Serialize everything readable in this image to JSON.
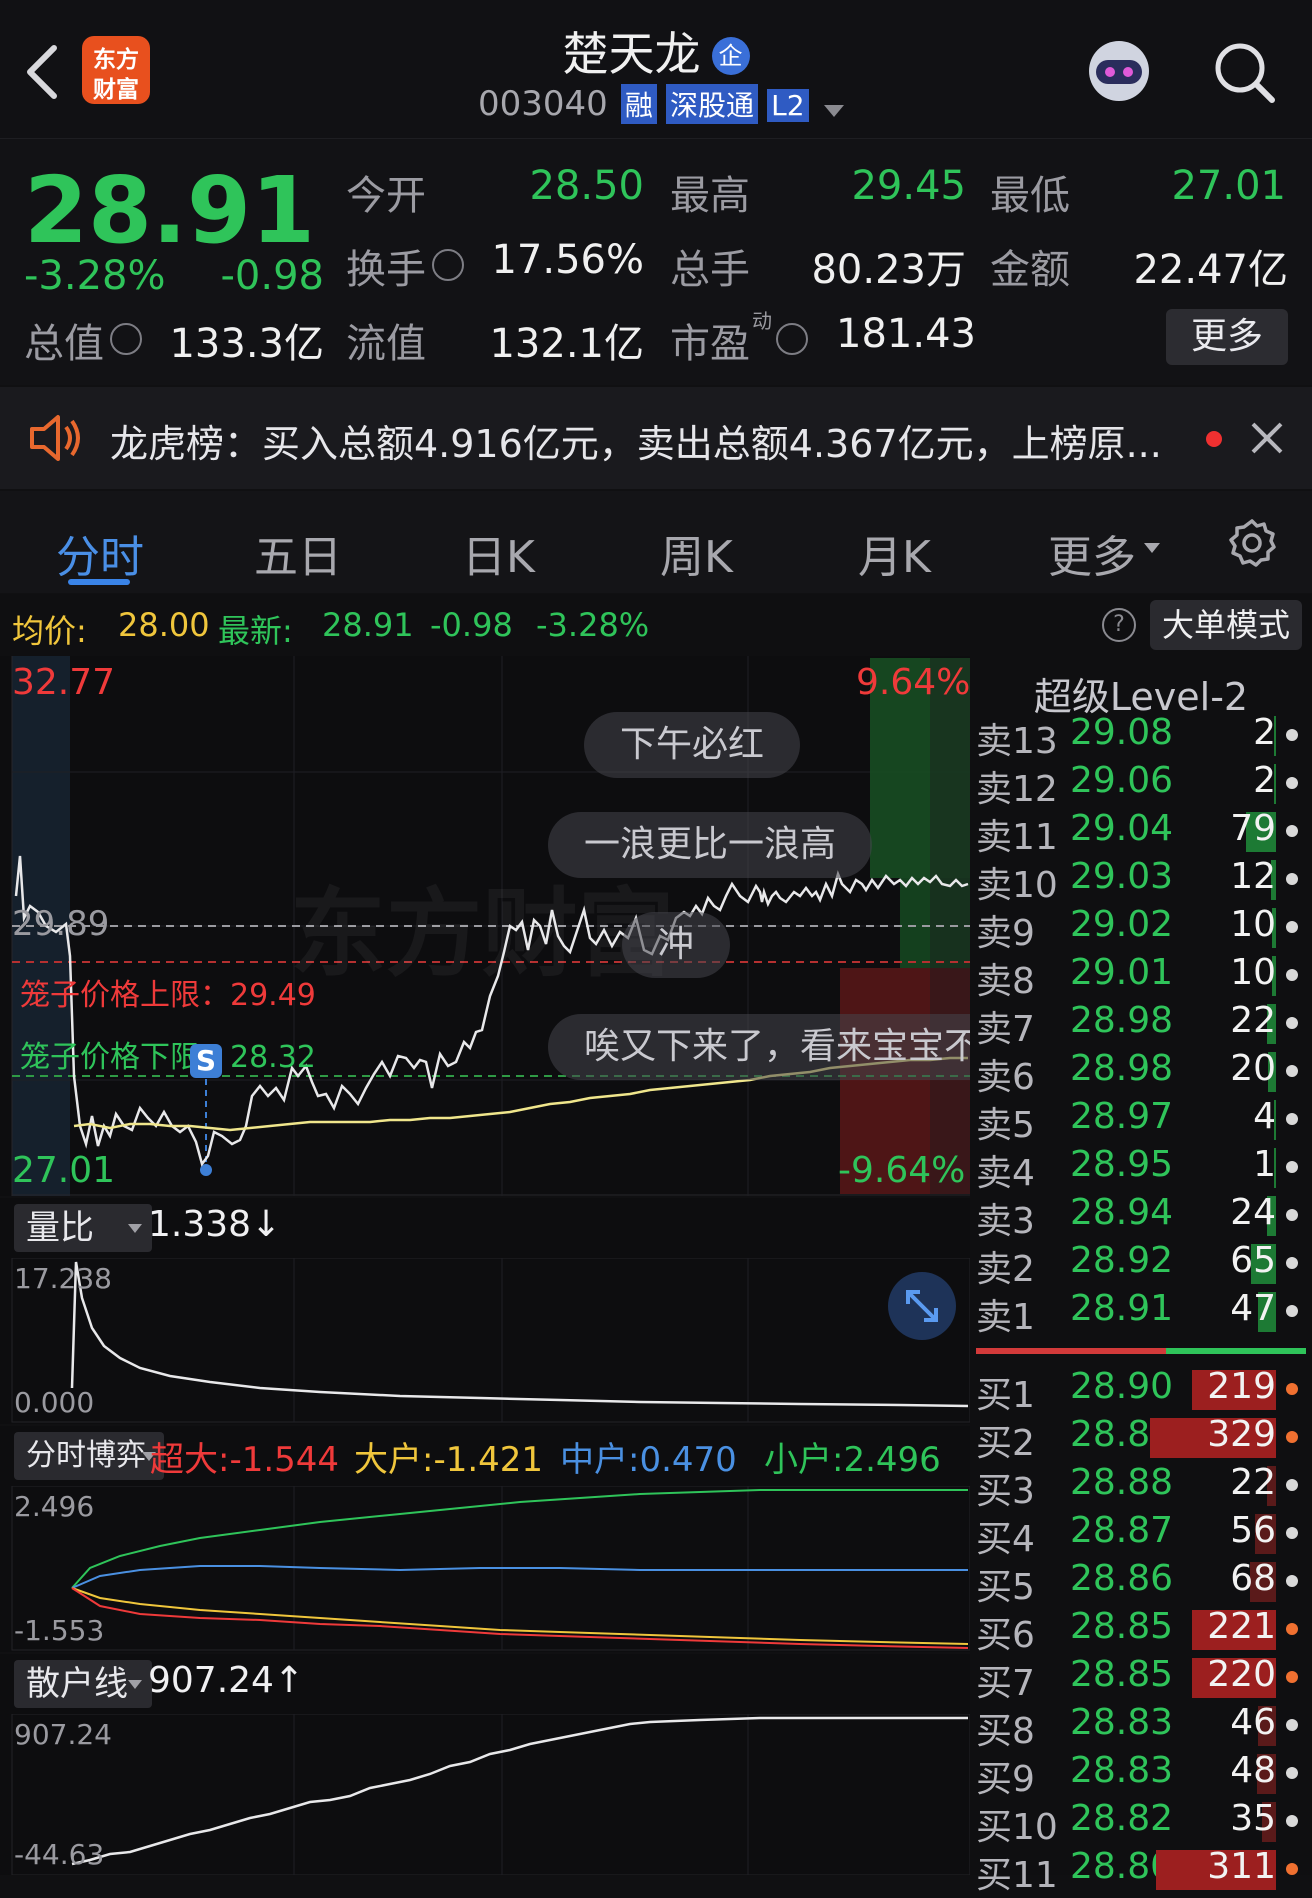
{
  "header": {
    "title": "楚天龙",
    "title_badge": "企",
    "code": "003040",
    "tags": [
      "融",
      "深股通",
      "L2"
    ],
    "logo_text_top": "东方",
    "logo_text_bottom": "财富"
  },
  "quote": {
    "price": "28.91",
    "change_pct": "-3.28%",
    "change": "-0.98",
    "fields": [
      {
        "label": "今开",
        "value": "28.50",
        "color": "green"
      },
      {
        "label": "最高",
        "value": "29.45",
        "color": "green"
      },
      {
        "label": "最低",
        "value": "27.01",
        "color": "green"
      },
      {
        "label": "换手",
        "value": "17.56%",
        "color": "white"
      },
      {
        "label": "总手",
        "value": "80.23万",
        "color": "white"
      },
      {
        "label": "金额",
        "value": "22.47亿",
        "color": "white"
      },
      {
        "label": "总值",
        "value": "133.3亿",
        "color": "white"
      },
      {
        "label": "流值",
        "value": "132.1亿",
        "color": "white"
      },
      {
        "label": "市盈",
        "value": "181.43",
        "color": "white"
      }
    ],
    "pe_superscript": "动",
    "more_button": "更多"
  },
  "banner": {
    "text": "龙虎榜：买入总额4.916亿元，卖出总额4.367亿元，上榜原..."
  },
  "tabs": [
    "分时",
    "五日",
    "日K",
    "周K",
    "月K",
    "更多"
  ],
  "active_tab": 0,
  "info_line": {
    "avg_label": "均价:",
    "avg_value": "28.00",
    "latest_label": "最新:",
    "latest_value": "28.91",
    "change": "-0.98",
    "change_pct": "-3.28%",
    "big_order_button": "大单模式"
  },
  "chart": {
    "y_high": "32.77",
    "y_low": "27.01",
    "pct_high": "9.64%",
    "pct_low": "-9.64%",
    "prev_close": "29.89",
    "cage_upper": "笼子价格上限：29.49",
    "cage_lower": "笼子价格下限：28.32",
    "sell_marker": "S",
    "watermark": "东方财富",
    "comments": [
      "下午必红",
      "一浪更比一浪高",
      "冲",
      "唉又下来了，看来宝宝不"
    ]
  },
  "level2_title": "超级Level-2",
  "order_book": {
    "sells": [
      {
        "label": "卖13",
        "price": "29.08",
        "vol": "2",
        "bar": 0
      },
      {
        "label": "卖12",
        "price": "29.06",
        "vol": "2",
        "bar": 0
      },
      {
        "label": "卖11",
        "price": "29.04",
        "vol": "79",
        "bar": 0.24
      },
      {
        "label": "卖10",
        "price": "29.03",
        "vol": "12",
        "bar": 0.04
      },
      {
        "label": "卖9",
        "price": "29.02",
        "vol": "10",
        "bar": 0.03
      },
      {
        "label": "卖8",
        "price": "29.01",
        "vol": "10",
        "bar": 0.03
      },
      {
        "label": "卖7",
        "price": "28.98",
        "vol": "22",
        "bar": 0.07
      },
      {
        "label": "卖6",
        "price": "28.98",
        "vol": "20",
        "bar": 0.06
      },
      {
        "label": "卖5",
        "price": "28.97",
        "vol": "4",
        "bar": 0.01
      },
      {
        "label": "卖4",
        "price": "28.95",
        "vol": "1",
        "bar": 0
      },
      {
        "label": "卖3",
        "price": "28.94",
        "vol": "24",
        "bar": 0.07
      },
      {
        "label": "卖2",
        "price": "28.92",
        "vol": "65",
        "bar": 0.2
      },
      {
        "label": "卖1",
        "price": "28.91",
        "vol": "47",
        "bar": 0.14
      }
    ],
    "buys": [
      {
        "label": "买1",
        "price": "28.90",
        "vol": "219",
        "bar": 0.67,
        "hot": true
      },
      {
        "label": "买2",
        "price": "28.89",
        "vol": "329",
        "bar": 1.0,
        "hot": true
      },
      {
        "label": "买3",
        "price": "28.88",
        "vol": "22",
        "bar": 0.07,
        "hot": false
      },
      {
        "label": "买4",
        "price": "28.87",
        "vol": "56",
        "bar": 0.17,
        "hot": false
      },
      {
        "label": "买5",
        "price": "28.86",
        "vol": "68",
        "bar": 0.21,
        "hot": false
      },
      {
        "label": "买6",
        "price": "28.85",
        "vol": "221",
        "bar": 0.67,
        "hot": true
      },
      {
        "label": "买7",
        "price": "28.85",
        "vol": "220",
        "bar": 0.67,
        "hot": true
      },
      {
        "label": "买8",
        "price": "28.83",
        "vol": "46",
        "bar": 0.14,
        "hot": false
      },
      {
        "label": "买9",
        "price": "28.83",
        "vol": "48",
        "bar": 0.15,
        "hot": false
      },
      {
        "label": "买10",
        "price": "28.82",
        "vol": "35",
        "bar": 0.11,
        "hot": false
      },
      {
        "label": "买11",
        "price": "28.80",
        "vol": "311",
        "bar": 0.95,
        "hot": true
      }
    ]
  },
  "vol_ratio": {
    "selector": "量比",
    "value": "1.338↓",
    "y_top": "17.238",
    "y_bottom": "0.000"
  },
  "game": {
    "selector": "分时博弈",
    "super": "超大:-1.544",
    "large": "大户:-1.421",
    "mid": "中户:0.470",
    "small": "小户:2.496",
    "y_top": "2.496",
    "y_bottom": "-1.553"
  },
  "retail": {
    "selector": "散户线",
    "value": "907.24↑",
    "y_top": "907.24",
    "y_bottom": "-44.63"
  },
  "colors": {
    "up": "#ef3a3a",
    "down": "#2fc45a",
    "accent": "#4a90e2",
    "avg": "#f0e68c"
  }
}
